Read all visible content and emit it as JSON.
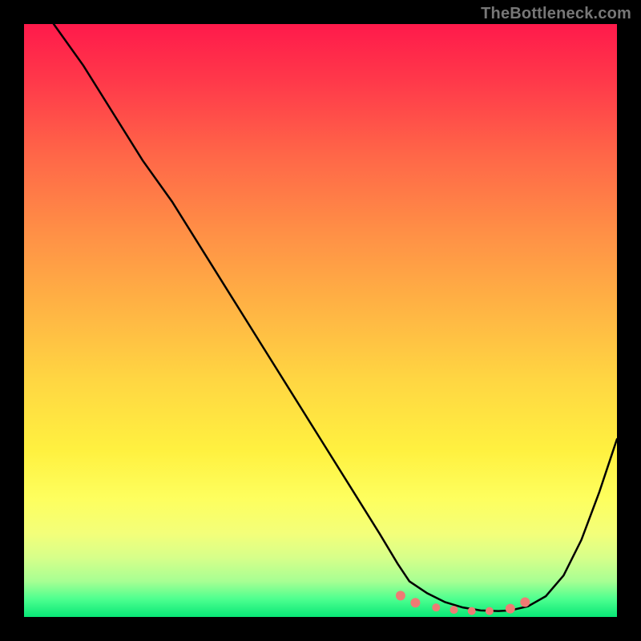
{
  "watermark": "TheBottleneck.com",
  "chart_data": {
    "type": "line",
    "title": "",
    "xlabel": "",
    "ylabel": "",
    "xlim": [
      0,
      100
    ],
    "ylim": [
      0,
      100
    ],
    "grid": false,
    "legend": false,
    "background": "red-yellow-green vertical gradient",
    "series": [
      {
        "name": "bottleneck-curve",
        "color": "#000000",
        "x": [
          5,
          10,
          15,
          20,
          25,
          30,
          35,
          40,
          45,
          50,
          55,
          60,
          63,
          65,
          68,
          71,
          74,
          77,
          80,
          82,
          85,
          88,
          91,
          94,
          97,
          100
        ],
        "values": [
          100,
          93,
          85,
          77,
          70,
          62,
          54,
          46,
          38,
          30,
          22,
          14,
          9,
          6,
          4,
          2.5,
          1.6,
          1.1,
          1,
          1.1,
          1.8,
          3.5,
          7,
          13,
          21,
          30
        ]
      }
    ],
    "markers": [
      {
        "name": "dot",
        "x": 63.5,
        "y": 3.6,
        "color": "#ef7b74",
        "r": 6
      },
      {
        "name": "dot",
        "x": 66.0,
        "y": 2.4,
        "color": "#ef7b74",
        "r": 6
      },
      {
        "name": "dot",
        "x": 69.5,
        "y": 1.6,
        "color": "#ef7b74",
        "r": 5
      },
      {
        "name": "dot",
        "x": 72.5,
        "y": 1.2,
        "color": "#ef7b74",
        "r": 5
      },
      {
        "name": "dot",
        "x": 75.5,
        "y": 1.0,
        "color": "#ef7b74",
        "r": 5
      },
      {
        "name": "dot",
        "x": 78.5,
        "y": 1.0,
        "color": "#ef7b74",
        "r": 5
      },
      {
        "name": "dot",
        "x": 82.0,
        "y": 1.4,
        "color": "#ef7b74",
        "r": 6
      },
      {
        "name": "dot",
        "x": 84.5,
        "y": 2.5,
        "color": "#ef7b74",
        "r": 6
      }
    ]
  }
}
